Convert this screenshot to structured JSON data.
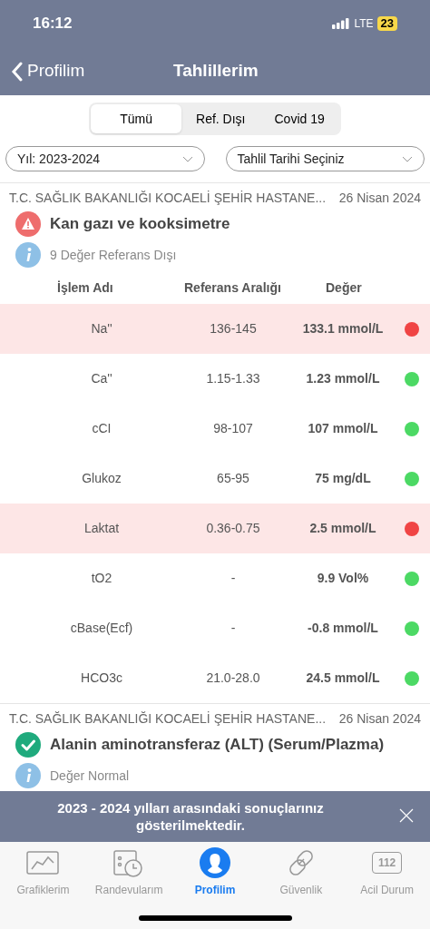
{
  "status_bar": {
    "time": "16:12",
    "network": "LTE",
    "battery": "23"
  },
  "nav": {
    "back": "Profilim",
    "title": "Tahlillerim"
  },
  "segments": [
    {
      "label": "Tümü",
      "selected": true
    },
    {
      "label": "Ref. Dışı",
      "selected": false
    },
    {
      "label": "Covid 19",
      "selected": false
    }
  ],
  "filters": [
    {
      "value": "Yıl: 2023-2024"
    },
    {
      "value": "Tahlil Tarihi Seçiniz"
    }
  ],
  "results": [
    {
      "hospital": "T.C. SAĞLIK BAKANLIĞI KOCAELİ ŞEHİR HASTANE...",
      "date": "26 Nisan 2024",
      "title": "Kan gazı ve kooksimetre",
      "kind": "warning",
      "info": "9 Değer Referans Dışı",
      "columns": [
        "İşlem Adı",
        "Referans Aralığı",
        "Değer"
      ],
      "rows": [
        {
          "name": "Na''",
          "range": "136-145",
          "value": "133.1 mmol/L",
          "out_of_range": true
        },
        {
          "name": "Ca''",
          "range": "1.15-1.33",
          "value": "1.23 mmol/L",
          "out_of_range": false
        },
        {
          "name": "cCI",
          "range": "98-107",
          "value": "107 mmol/L",
          "out_of_range": false
        },
        {
          "name": "Glukoz",
          "range": "65-95",
          "value": "75 mg/dL",
          "out_of_range": false
        },
        {
          "name": "Laktat",
          "range": "0.36-0.75",
          "value": "2.5 mmol/L",
          "out_of_range": true
        },
        {
          "name": "tO2",
          "range": "-",
          "value": "9.9 Vol%",
          "out_of_range": false
        },
        {
          "name": "cBase(Ecf)",
          "range": "-",
          "value": "-0.8 mmol/L",
          "out_of_range": false
        },
        {
          "name": "HCO3c",
          "range": "21.0-28.0",
          "value": "24.5 mmol/L",
          "out_of_range": false
        }
      ]
    },
    {
      "hospital": "T.C. SAĞLIK BAKANLIĞI KOCAELİ ŞEHİR HASTANE...",
      "date": "26 Nisan 2024",
      "title": "Alanin aminotransferaz (ALT) (Serum/Plazma)",
      "kind": "ok",
      "info": "Değer Normal"
    }
  ],
  "toast": {
    "message": "2023 - 2024 yılları arasındaki sonuçlarınız gösterilmektedir."
  },
  "tab_bar": [
    {
      "label": "Grafiklerim",
      "kind": "chart",
      "selected": false
    },
    {
      "label": "Randevularım",
      "kind": "calendar",
      "selected": false
    },
    {
      "label": "Profilim",
      "kind": "person",
      "selected": true
    },
    {
      "label": "Güvenlik",
      "kind": "link",
      "selected": false
    },
    {
      "label": "Acil Durum",
      "kind": "emergency",
      "icon_text": "112",
      "selected": false
    }
  ]
}
